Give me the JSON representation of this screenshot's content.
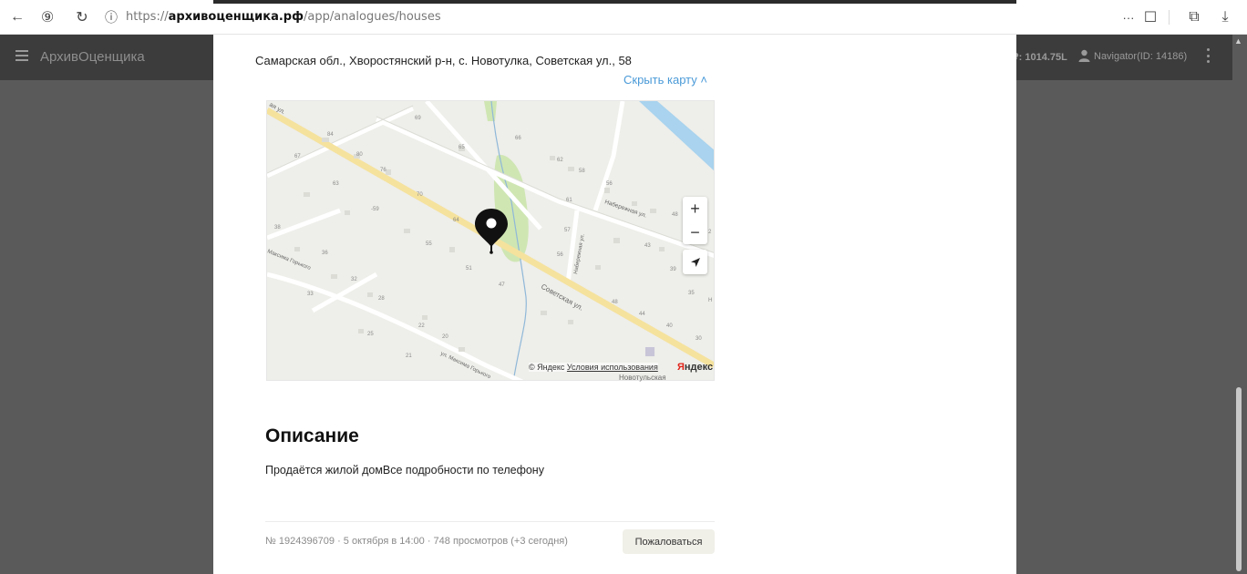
{
  "browser": {
    "back_glyph": "←",
    "yandex_glyph": "⑨",
    "reload_glyph": "↻",
    "info_glyph": "ⓘ",
    "url_scheme": "https://",
    "url_host": "архивоценщика.рф",
    "url_path": "/app/analogues/houses",
    "menu_glyph": "···",
    "bookmark_glyph": "☐",
    "extensions_glyph": "⧉",
    "download_glyph": "⤓"
  },
  "header": {
    "app_name": "АрхивОценщика",
    "balance": "₽: 1014.75L",
    "user_label": "Navigator(ID: 14186)"
  },
  "listing": {
    "address": "Самарская обл., Хворостянский р-н, с. Новотулка, Советская ул., 58",
    "hide_map": "Скрыть карту ˄",
    "map": {
      "zoom_in": "+",
      "zoom_out": "−",
      "copyright": "© Яндекс",
      "terms": "Условия использования",
      "logo_prefix": "Я",
      "logo_suffix": "ндекс",
      "bottom_label": "Новотульская",
      "streets": {
        "sovetskaya": "Советская ул.",
        "naberezhnaya": "Набережная ул.",
        "naberezhnaya_v": "Набережная ул.",
        "gorkogo": "ул. Максима Горького",
        "gorkogo_left": "Максима Горького",
        "top_left": "ая ул."
      },
      "houses": [
        "84",
        "69",
        "67",
        "80",
        "76",
        "65",
        "66",
        "62",
        "58",
        "63",
        "70",
        "-59",
        "61",
        "56",
        "48",
        "64",
        "57",
        "38",
        "55",
        "56",
        "43",
        "36",
        "51",
        "39",
        "32",
        "47",
        "35",
        "33",
        "28",
        "48",
        "44",
        "40",
        "22",
        "20",
        "30",
        "25",
        "21",
        "2",
        "Н"
      ]
    },
    "description_title": "Описание",
    "description_text": "Продаётся жилой домВсе подробности по телефону",
    "meta": "№ 1924396709 · 5 октября в 14:00 · 748 просмотров (+3 сегодня)",
    "report_button": "Пожаловаться"
  }
}
